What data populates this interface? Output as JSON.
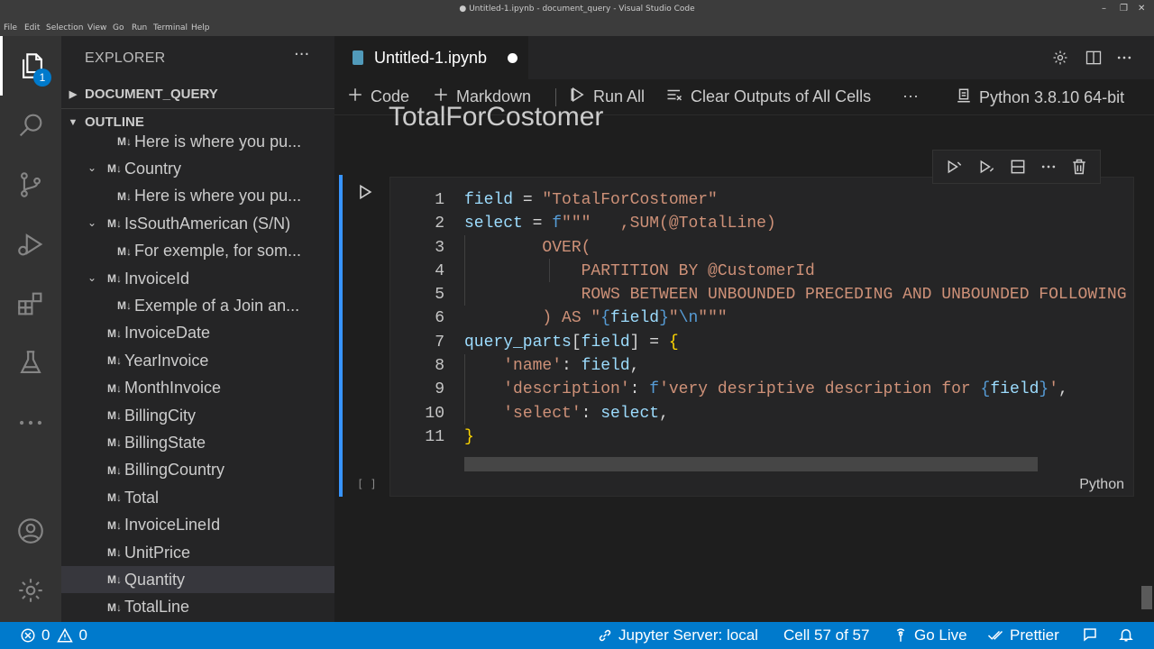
{
  "window": {
    "title": "● Untitled-1.ipynb - document_query - Visual Studio Code",
    "minimize": "–",
    "maximize": "❐",
    "close": "✕"
  },
  "menu": [
    "File",
    "Edit",
    "Selection",
    "View",
    "Go",
    "Run",
    "Terminal",
    "Help"
  ],
  "activity": {
    "explorer_badge": "1",
    "items": [
      "files-icon",
      "search-icon",
      "source-control-icon",
      "run-debug-icon",
      "extensions-icon",
      "testing-icon",
      "more-icon",
      "account-icon",
      "manage-gear-icon"
    ]
  },
  "sidebar": {
    "title": "EXPLORER",
    "more": "···",
    "folder": "DOCUMENT_QUERY",
    "outline_title": "OUTLINE",
    "md_marker": "M↓",
    "outline": [
      {
        "label": "Here is where you pu...",
        "level": 2,
        "chevron": ""
      },
      {
        "label": "Country",
        "level": 1,
        "chevron": "⌄"
      },
      {
        "label": "Here is where you pu...",
        "level": 2,
        "chevron": ""
      },
      {
        "label": "IsSouthAmerican (S/N)",
        "level": 1,
        "chevron": "⌄"
      },
      {
        "label": "For exemple, for som...",
        "level": 2,
        "chevron": ""
      },
      {
        "label": "InvoiceId",
        "level": 1,
        "chevron": "⌄"
      },
      {
        "label": "Exemple of a Join an...",
        "level": 2,
        "chevron": ""
      },
      {
        "label": "InvoiceDate",
        "level": 1,
        "chevron": ""
      },
      {
        "label": "YearInvoice",
        "level": 1,
        "chevron": ""
      },
      {
        "label": "MonthInvoice",
        "level": 1,
        "chevron": ""
      },
      {
        "label": "BillingCity",
        "level": 1,
        "chevron": ""
      },
      {
        "label": "BillingState",
        "level": 1,
        "chevron": ""
      },
      {
        "label": "BillingCountry",
        "level": 1,
        "chevron": ""
      },
      {
        "label": "Total",
        "level": 1,
        "chevron": ""
      },
      {
        "label": "InvoiceLineId",
        "level": 1,
        "chevron": ""
      },
      {
        "label": "UnitPrice",
        "level": 1,
        "chevron": ""
      },
      {
        "label": "Quantity",
        "level": 1,
        "chevron": "",
        "selected": true
      },
      {
        "label": "TotalLine",
        "level": 1,
        "chevron": ""
      }
    ]
  },
  "editor": {
    "tab_label": "Untitled-1.ipynb",
    "toolbar": {
      "code": "Code",
      "markdown": "Markdown",
      "run_all": "Run All",
      "clear_outputs": "Clear Outputs of All Cells",
      "more": "···",
      "kernel": "Python 3.8.10 64-bit"
    },
    "previous_heading": "TotalForCostomer",
    "cell": {
      "exec_count": "[ ]",
      "language": "Python",
      "lines": [
        {
          "n": "1",
          "tokens": [
            [
              "var",
              "field"
            ],
            [
              "pl",
              " = "
            ],
            [
              "str",
              "\"TotalForCostomer\""
            ]
          ]
        },
        {
          "n": "2",
          "tokens": [
            [
              "var",
              "select"
            ],
            [
              "pl",
              " = "
            ],
            [
              "kw",
              "f"
            ],
            [
              "str",
              "\"\"\"   ,SUM(@TotalLine)"
            ]
          ]
        },
        {
          "n": "3",
          "tokens": [
            [
              "str",
              "        OVER("
            ]
          ]
        },
        {
          "n": "4",
          "tokens": [
            [
              "str",
              "            PARTITION BY @CustomerId"
            ]
          ]
        },
        {
          "n": "5",
          "tokens": [
            [
              "str",
              "            ROWS BETWEEN UNBOUNDED PRECEDING AND UNBOUNDED FOLLOWING"
            ]
          ]
        },
        {
          "n": "6",
          "tokens": [
            [
              "str",
              "        ) AS \""
            ],
            [
              "kw",
              "{"
            ],
            [
              "var",
              "field"
            ],
            [
              "kw",
              "}"
            ],
            [
              "str",
              "\""
            ],
            [
              "kw",
              "\\n"
            ],
            [
              "str",
              "\"\"\""
            ]
          ]
        },
        {
          "n": "7",
          "tokens": [
            [
              "var",
              "query_parts"
            ],
            [
              "pl",
              "["
            ],
            [
              "var",
              "field"
            ],
            [
              "pl",
              "] = "
            ],
            [
              "br",
              "{"
            ]
          ]
        },
        {
          "n": "8",
          "tokens": [
            [
              "pl",
              "    "
            ],
            [
              "str",
              "'name'"
            ],
            [
              "pl",
              ": "
            ],
            [
              "var",
              "field"
            ],
            [
              "pl",
              ","
            ]
          ]
        },
        {
          "n": "9",
          "tokens": [
            [
              "pl",
              "    "
            ],
            [
              "str",
              "'description'"
            ],
            [
              "pl",
              ": "
            ],
            [
              "kw",
              "f"
            ],
            [
              "str",
              "'very desriptive description for "
            ],
            [
              "kw",
              "{"
            ],
            [
              "var",
              "field"
            ],
            [
              "kw",
              "}"
            ],
            [
              "str",
              "'"
            ],
            [
              "pl",
              ","
            ]
          ]
        },
        {
          "n": "10",
          "tokens": [
            [
              "pl",
              "    "
            ],
            [
              "str",
              "'select'"
            ],
            [
              "pl",
              ": "
            ],
            [
              "var",
              "select"
            ],
            [
              "pl",
              ","
            ]
          ]
        },
        {
          "n": "11",
          "tokens": [
            [
              "br",
              "}"
            ]
          ]
        }
      ]
    }
  },
  "statusbar": {
    "errors": "0",
    "warnings": "0",
    "jupyter": "Jupyter Server: local",
    "cell_pos": "Cell 57 of 57",
    "go_live": "Go Live",
    "prettier": "Prettier"
  }
}
